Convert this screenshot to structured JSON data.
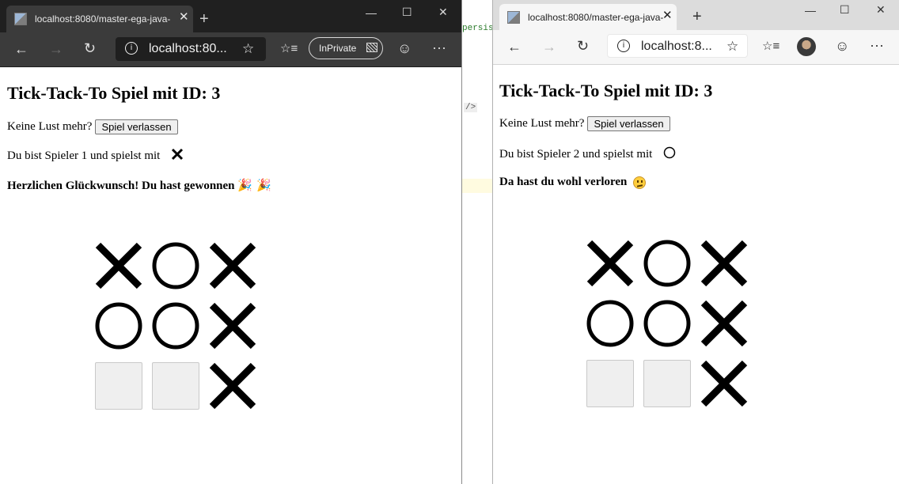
{
  "left_window": {
    "tab_title": "localhost:8080/master-ega-java-",
    "tab_close": "✕",
    "new_tab": "+",
    "url": "localhost:80...",
    "inprivate_label": "InPrivate",
    "controls": {
      "minimize": "—",
      "maximize": "☐",
      "close": "✕"
    },
    "page": {
      "title": "Tick-Tack-To Spiel mit ID: 3",
      "leave_text": "Keine Lust mehr?",
      "leave_button": "Spiel verlassen",
      "player_text": "Du bist Spieler 1 und spielst mit",
      "player_symbol": "X",
      "result_text": "Herzlichen Glückwunsch! Du hast gewonnen",
      "result_emoji": "🎉 🎉",
      "board": [
        "X",
        "O",
        "X",
        "O",
        "O",
        "X",
        "",
        "",
        "X"
      ]
    }
  },
  "right_window": {
    "tab_title": "localhost:8080/master-ega-java-",
    "tab_close": "✕",
    "new_tab": "+",
    "url": "localhost:8...",
    "controls": {
      "minimize": "—",
      "maximize": "☐",
      "close": "✕"
    },
    "page": {
      "title": "Tick-Tack-To Spiel mit ID: 3",
      "leave_text": "Keine Lust mehr?",
      "leave_button": "Spiel verlassen",
      "player_text": "Du bist Spieler 2 und spielst mit",
      "player_symbol": "O",
      "result_text": "Da hast du wohl verloren",
      "board": [
        "X",
        "O",
        "X",
        "O",
        "O",
        "X",
        "",
        "",
        "X"
      ]
    }
  },
  "background_code": {
    "fragment1": "persis",
    "fragment2": "/>"
  },
  "icons": {
    "back": "←",
    "forward": "→",
    "refresh": "↻",
    "info": "i",
    "star": "☆",
    "favorites": "☆≡",
    "feedback": "☺",
    "more": "···"
  }
}
